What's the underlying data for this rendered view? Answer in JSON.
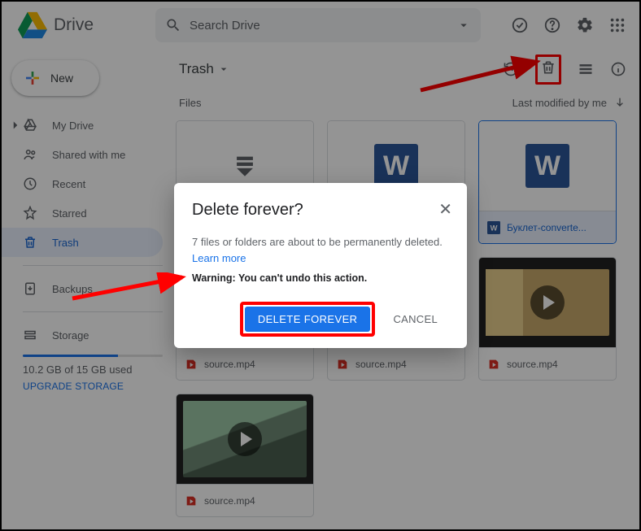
{
  "header": {
    "app_name": "Drive",
    "search_placeholder": "Search Drive"
  },
  "sidebar": {
    "new_label": "New",
    "items": [
      {
        "label": "My Drive"
      },
      {
        "label": "Shared with me"
      },
      {
        "label": "Recent"
      },
      {
        "label": "Starred"
      },
      {
        "label": "Trash"
      },
      {
        "label": "Backups"
      }
    ],
    "storage_label": "Storage",
    "storage_text": "10.2 GB of 15 GB used",
    "storage_link": "UPGRADE STORAGE"
  },
  "content": {
    "location": "Trash",
    "section": "Files",
    "sort_label": "Last modified by me"
  },
  "files": [
    {
      "name": "",
      "type": "stack"
    },
    {
      "name": "",
      "type": "word"
    },
    {
      "name": "Буклет-converte...",
      "type": "word",
      "selected": true
    },
    {
      "name": "source.mp4",
      "type": "video",
      "thumb": "vid-bg"
    },
    {
      "name": "source.mp4",
      "type": "video",
      "thumb": "vid-bg"
    },
    {
      "name": "source.mp4",
      "type": "video",
      "thumb": "vid-bg3"
    },
    {
      "name": "source.mp4",
      "type": "video",
      "thumb": "vid-bg2"
    }
  ],
  "dialog": {
    "title": "Delete forever?",
    "body": "7 files or folders are about to be permanently deleted.",
    "learn_more": "Learn more",
    "warning": "Warning: You can't undo this action.",
    "confirm": "DELETE FOREVER",
    "cancel": "CANCEL"
  }
}
